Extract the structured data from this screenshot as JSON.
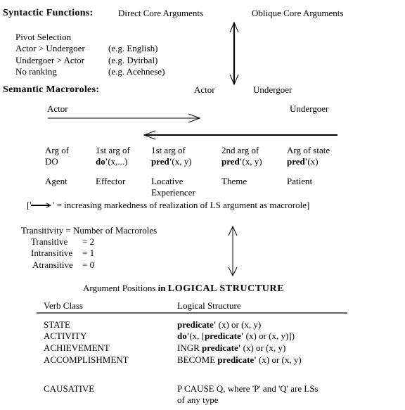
{
  "syntactic": {
    "heading": "Syntactic Functions:",
    "direct": "Direct Core Arguments",
    "oblique": "Oblique Core Arguments"
  },
  "pivot": {
    "title": "Pivot Selection",
    "rows": [
      {
        "rank": "Actor > Undergoer",
        "example": "(e.g. English)"
      },
      {
        "rank": "Undergoer > Actor",
        "example": "(e.g. Dyirbal)"
      },
      {
        "rank": "No ranking",
        "example": "(e.g. Acehnese)"
      }
    ]
  },
  "semantic": {
    "heading": "Semantic Macroroles:",
    "actor": "Actor",
    "undergoer": "Undergoer"
  },
  "continuum": {
    "actor": "Actor",
    "undergoer": "Undergoer",
    "columns": [
      {
        "line1": "Arg of",
        "line2_bold": "",
        "line2": "DO",
        "role1": "Agent",
        "role2": ""
      },
      {
        "line1": "1st arg of",
        "line2_bold": "do'",
        "line2": "(x,...)",
        "role1": "Effector",
        "role2": ""
      },
      {
        "line1": "1st arg of",
        "line2_bold": "pred'",
        "line2": "(x, y)",
        "role1": "Locative",
        "role2": "Experiencer"
      },
      {
        "line1": "2nd arg of",
        "line2_bold": "pred'",
        "line2": "(x, y)",
        "role1": "Theme",
        "role2": ""
      },
      {
        "line1": "Arg of state",
        "line2_bold": "pred'",
        "line2": "(x)",
        "role1": "Patient",
        "role2": ""
      }
    ],
    "legend_open": "['",
    "legend_close": "' = increasing markedness of realization of LS argument as macrorole]"
  },
  "transitivity": {
    "title": "Transitivity = Number of Macroroles",
    "rows": [
      {
        "label": "Transitive",
        "value": "= 2"
      },
      {
        "label": "Intransitive",
        "value": "= 1"
      },
      {
        "label": "Atransitive",
        "value": "= 0"
      }
    ]
  },
  "ls_table": {
    "title_plain": "Argument Positions ",
    "title_in": "in ",
    "title_bold": "LOGICAL STRUCTURE",
    "col1": "Verb Class",
    "col2": "Logical Structure",
    "rows": [
      {
        "cls": "STATE",
        "parts": [
          {
            "b": "predicate'"
          },
          {
            "t": " (x) or (x, y)"
          }
        ]
      },
      {
        "cls": "ACTIVITY",
        "parts": [
          {
            "b": "do'"
          },
          {
            "t": "(x, ["
          },
          {
            "b": "predicate'"
          },
          {
            "t": " (x) or (x, y)])"
          }
        ]
      },
      {
        "cls": "ACHIEVEMENT",
        "parts": [
          {
            "t": "INGR "
          },
          {
            "b": "predicate'"
          },
          {
            "t": " (x) or (x, y)"
          }
        ]
      },
      {
        "cls": "ACCOMPLISHMENT",
        "parts": [
          {
            "t": "BECOME "
          },
          {
            "b": "predicate'"
          },
          {
            "t": " (x) or (x, y)"
          }
        ]
      }
    ],
    "causative": {
      "cls": "CAUSATIVE",
      "line1": "P CAUSE Q, where 'P' and 'Q' are LSs",
      "line2": "of any type"
    }
  }
}
